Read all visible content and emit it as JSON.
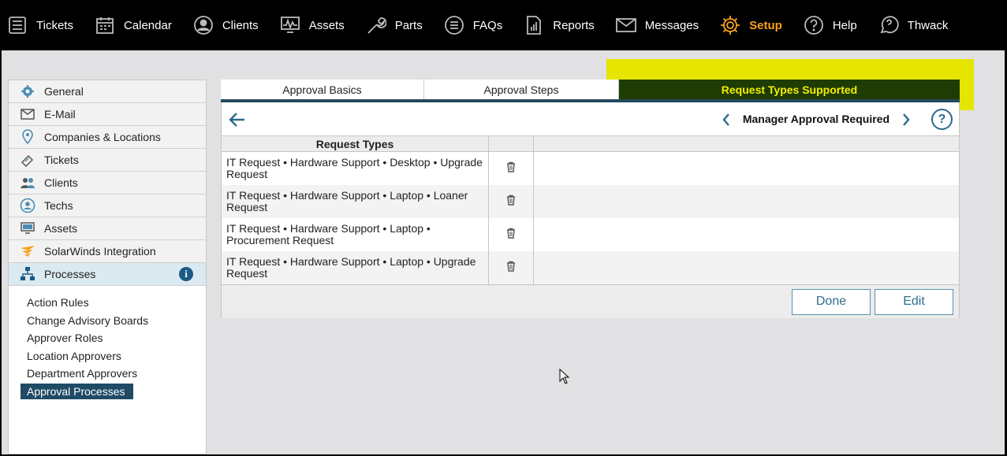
{
  "nav": [
    {
      "label": "Tickets",
      "icon": "list-icon"
    },
    {
      "label": "Calendar",
      "icon": "calendar-icon"
    },
    {
      "label": "Clients",
      "icon": "user-circle-icon"
    },
    {
      "label": "Assets",
      "icon": "monitor-icon"
    },
    {
      "label": "Parts",
      "icon": "wrench-icon"
    },
    {
      "label": "FAQs",
      "icon": "faq-list-icon"
    },
    {
      "label": "Reports",
      "icon": "report-icon"
    },
    {
      "label": "Messages",
      "icon": "envelope-icon"
    },
    {
      "label": "Setup",
      "icon": "gear-icon",
      "active": true
    },
    {
      "label": "Help",
      "icon": "help-circle-icon"
    },
    {
      "label": "Thwack",
      "icon": "chat-icon"
    }
  ],
  "sidebar": {
    "items": [
      {
        "label": "General",
        "icon": "gear-icon"
      },
      {
        "label": "E-Mail",
        "icon": "envelope-icon"
      },
      {
        "label": "Companies & Locations",
        "icon": "location-pin-icon"
      },
      {
        "label": "Tickets",
        "icon": "ticket-icon"
      },
      {
        "label": "Clients",
        "icon": "users-icon"
      },
      {
        "label": "Techs",
        "icon": "user-circle-icon"
      },
      {
        "label": "Assets",
        "icon": "monitor-icon"
      },
      {
        "label": "SolarWinds Integration",
        "icon": "solarwinds-icon"
      },
      {
        "label": "Processes",
        "icon": "org-chart-icon",
        "info": "i"
      }
    ],
    "subitems": [
      "Action Rules",
      "Change Advisory Boards",
      "Approver Roles",
      "Location Approvers",
      "Department Approvers",
      "Approval Processes"
    ]
  },
  "tabs": [
    "Approval Basics",
    "Approval Steps",
    "Request Types Supported"
  ],
  "step": {
    "title": "Manager Approval Required",
    "help": "?"
  },
  "table": {
    "header": "Request Types",
    "rows": [
      "IT Request • Hardware Support • Desktop • Upgrade Request",
      "IT Request • Hardware Support • Laptop • Loaner Request",
      "IT Request • Hardware Support • Laptop • Procurement Request",
      "IT Request • Hardware Support • Laptop • Upgrade Request"
    ]
  },
  "buttons": {
    "done": "Done",
    "edit": "Edit"
  },
  "colors": {
    "active_nav": "#f7a21b",
    "active_tab_bg": "#1f3c05",
    "active_tab_text": "#f2ee00",
    "highlight": "#e5e500",
    "selected_sub_bg": "#1f4b66"
  }
}
